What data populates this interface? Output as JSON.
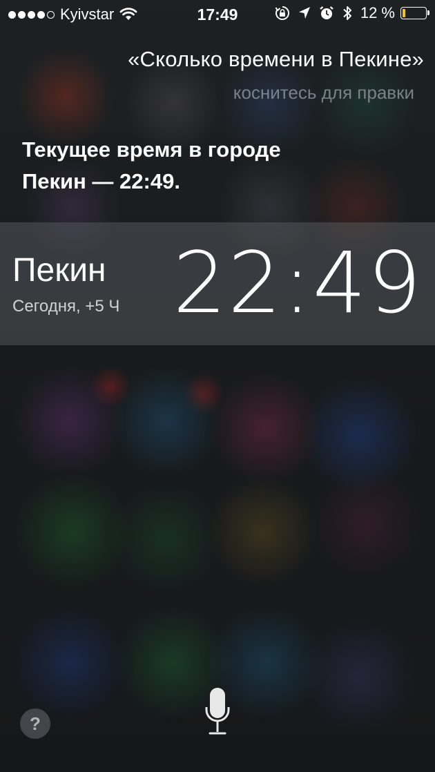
{
  "status_bar": {
    "signal_dots": [
      "full",
      "full",
      "full",
      "full",
      "empty"
    ],
    "carrier": "Kyivstar",
    "time": "17:49",
    "battery_percent_label": "12 %",
    "battery_level": 0.12,
    "battery_color": "#f3c31a",
    "icons": [
      "wifi-icon",
      "orientation-lock-icon",
      "location-icon",
      "alarm-icon",
      "bluetooth-icon",
      "battery-icon"
    ]
  },
  "siri": {
    "query": "«Сколько времени в Пекине»",
    "edit_hint": "коснитесь для правки",
    "answer_line1": "Текущее время в городе",
    "answer_line2": "Пекин — 22:49."
  },
  "clock_card": {
    "city": "Пекин",
    "offset": "Сегодня, +5 Ч",
    "time": "22:49"
  },
  "bottom": {
    "help_label": "?",
    "mic_icon": "microphone-icon"
  }
}
